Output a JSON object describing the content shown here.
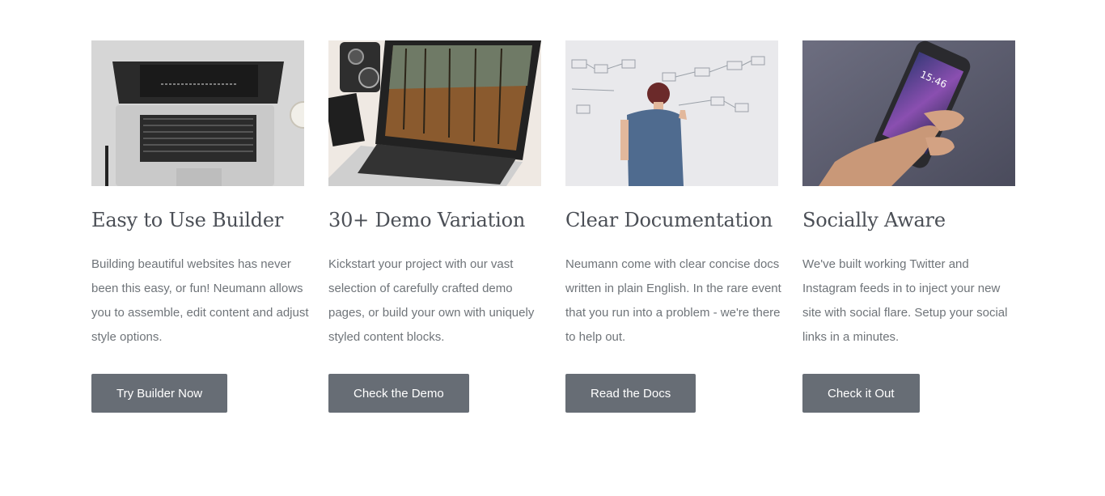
{
  "features": [
    {
      "image_alt": "laptop-on-desk-image",
      "title": "Easy to Use Builder",
      "text": "Building beautiful websites has never been this easy, or fun! Neumann allows you to assemble, edit content and adjust style options.",
      "button_label": "Try Builder Now"
    },
    {
      "image_alt": "laptop-with-camera-image",
      "title": "30+ Demo Variation",
      "text": "Kickstart your project with our vast selection of carefully crafted demo pages, or build your own with uniquely styled content blocks.",
      "button_label": "Check the Demo"
    },
    {
      "image_alt": "man-at-whiteboard-image",
      "title": "Clear Documentation",
      "text": "Neumann come with clear concise docs written in plain English. In the rare event that you run into a problem - we're there to help out.",
      "button_label": "Read the Docs"
    },
    {
      "image_alt": "hand-holding-phone-image",
      "title": "Socially Aware",
      "text": "We've built working Twitter and Instagram feeds in to inject your new site with social flare. Setup your social links in a minutes.",
      "button_label": "Check it Out"
    }
  ],
  "colors": {
    "button_bg": "#676d75",
    "title": "#4b4f56",
    "body_text": "#6f7479"
  }
}
